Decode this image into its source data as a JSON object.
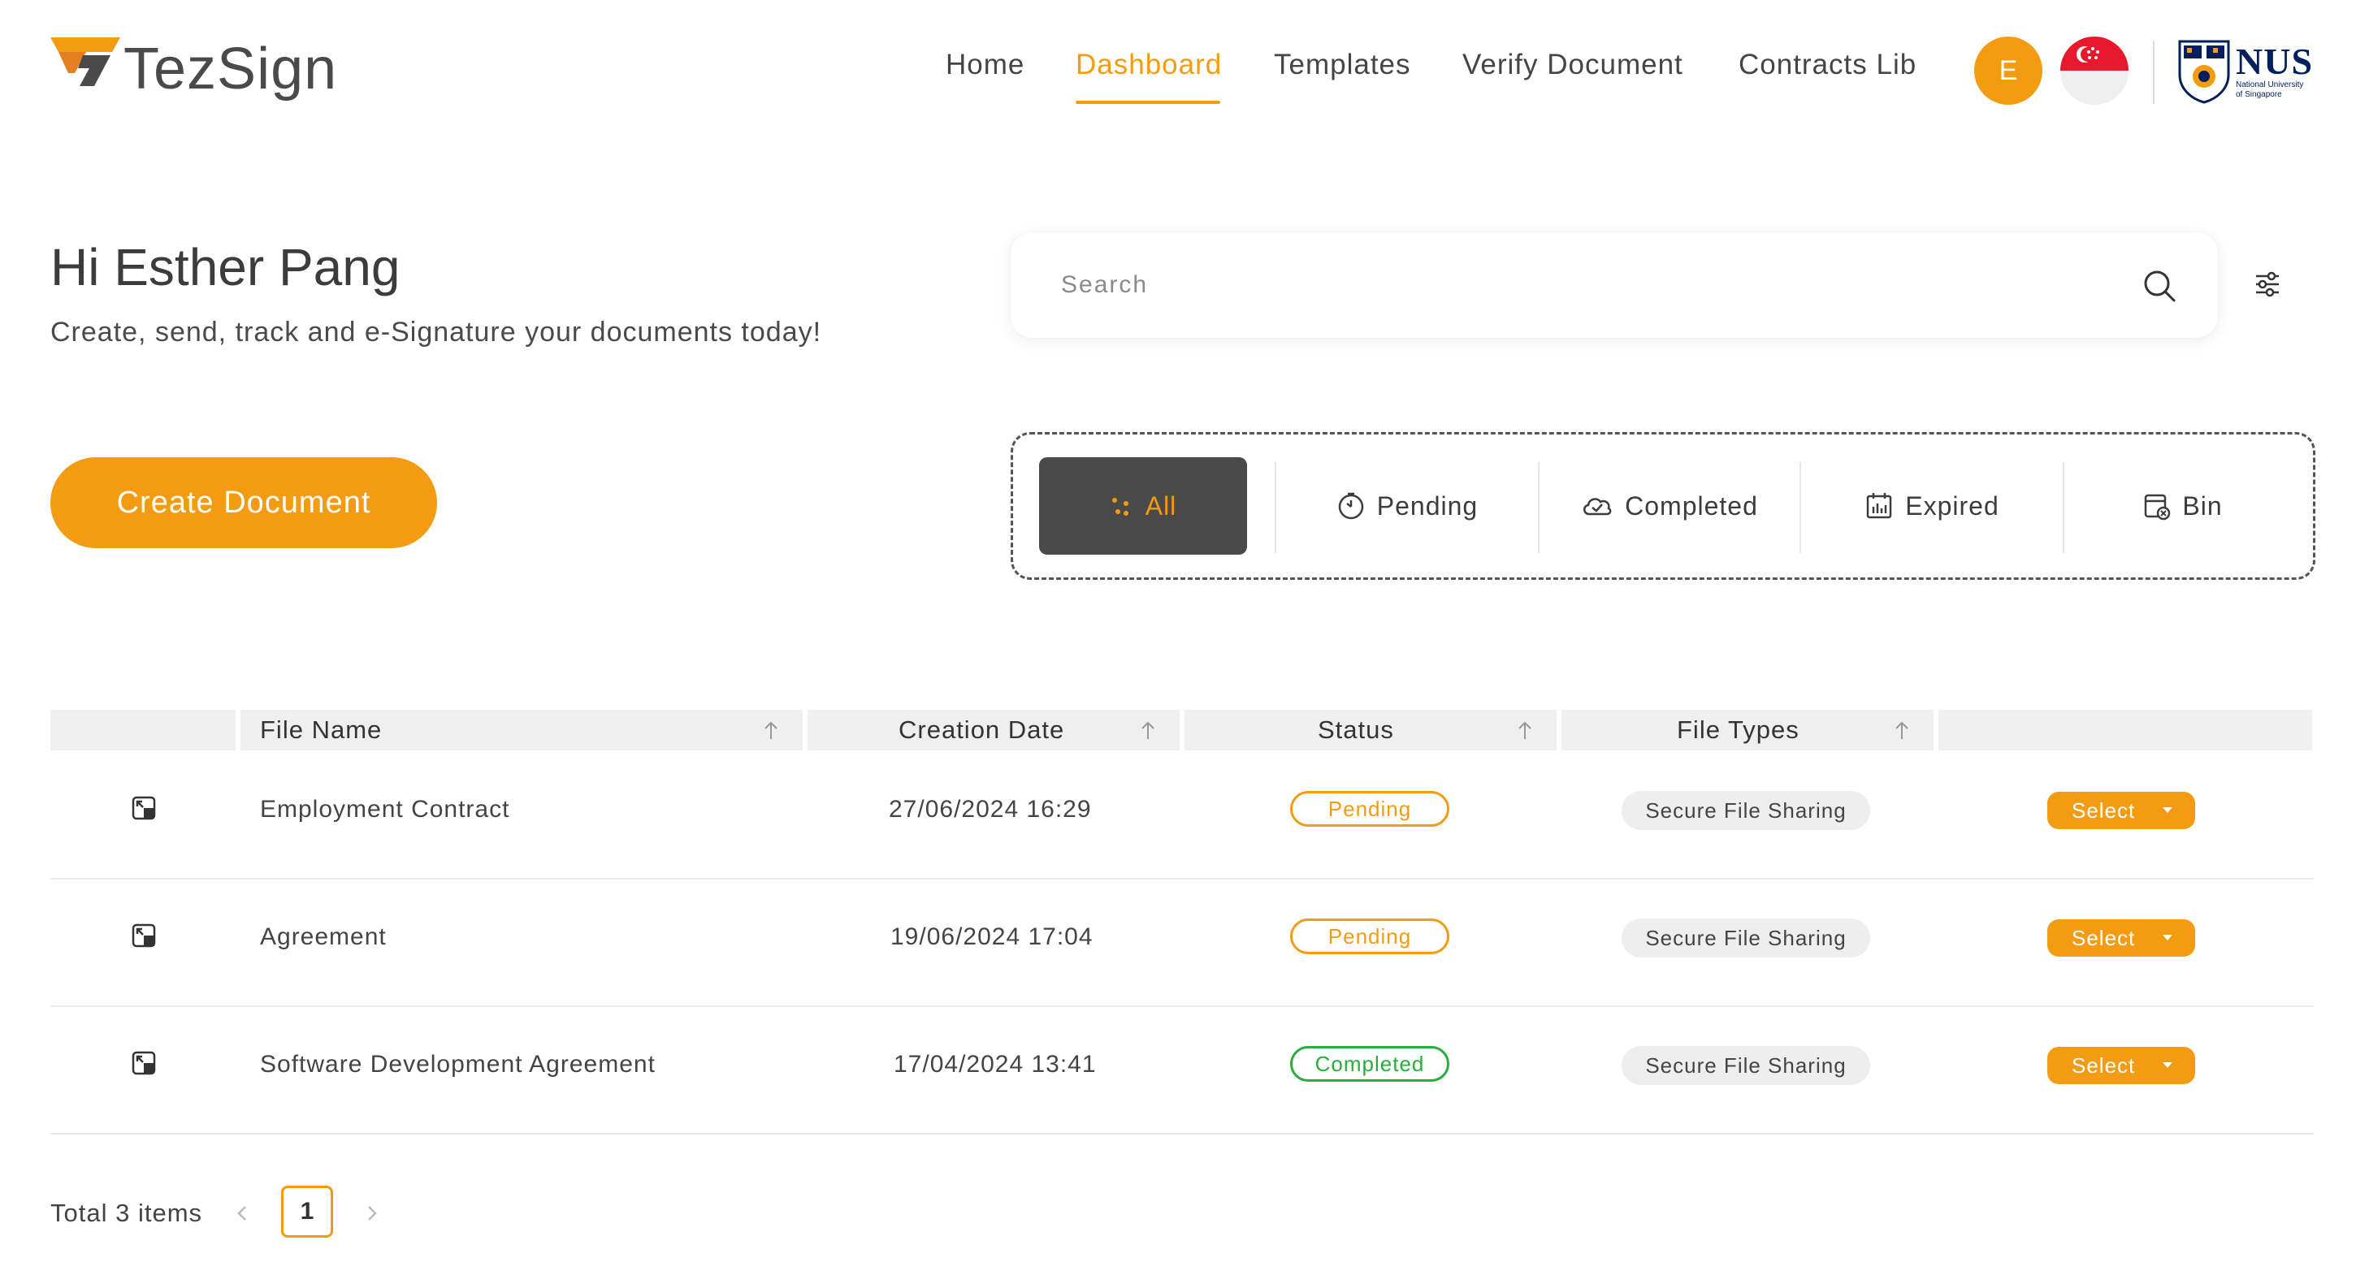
{
  "app": {
    "name": "TezSign"
  },
  "nav": {
    "items": [
      {
        "label": "Home",
        "active": false
      },
      {
        "label": "Dashboard",
        "active": true
      },
      {
        "label": "Templates",
        "active": false
      },
      {
        "label": "Verify Document",
        "active": false
      },
      {
        "label": "Contracts Lib",
        "active": false
      }
    ],
    "avatar_initial": "E",
    "partner_logo": {
      "name": "NUS",
      "subtitle_line1": "National University",
      "subtitle_line2": "of Singapore"
    }
  },
  "greeting": {
    "title": "Hi Esther Pang",
    "subtitle": "Create, send, track and e-Signature your documents today!"
  },
  "search": {
    "placeholder": "Search",
    "value": ""
  },
  "create_button": {
    "label": "Create Document"
  },
  "tabs": [
    {
      "label": "All",
      "icon": "dots-icon",
      "active": true
    },
    {
      "label": "Pending",
      "icon": "clock-icon",
      "active": false
    },
    {
      "label": "Completed",
      "icon": "cloud-check-icon",
      "active": false
    },
    {
      "label": "Expired",
      "icon": "calendar-chart-icon",
      "active": false
    },
    {
      "label": "Bin",
      "icon": "bin-icon",
      "active": false
    }
  ],
  "table": {
    "columns": [
      "File Name",
      "Creation Date",
      "Status",
      "File Types"
    ],
    "rows": [
      {
        "file_name": "Employment Contract",
        "creation_date": "27/06/2024 16:29",
        "status": "Pending",
        "file_type": "Secure File Sharing",
        "action": "Select"
      },
      {
        "file_name": "Agreement",
        "creation_date": "19/06/2024 17:04",
        "status": "Pending",
        "file_type": "Secure File Sharing",
        "action": "Select"
      },
      {
        "file_name": "Software Development Agreement",
        "creation_date": "17/04/2024 13:41",
        "status": "Completed",
        "file_type": "Secure File Sharing",
        "action": "Select"
      }
    ]
  },
  "pagination": {
    "total_label": "Total 3 items",
    "current_page": "1"
  },
  "colors": {
    "accent": "#f39c12",
    "completed": "#27ae3c",
    "active_tab_bg": "#4a4a4a",
    "flag_red": "#e8192c",
    "nus_blue": "#00205b"
  }
}
